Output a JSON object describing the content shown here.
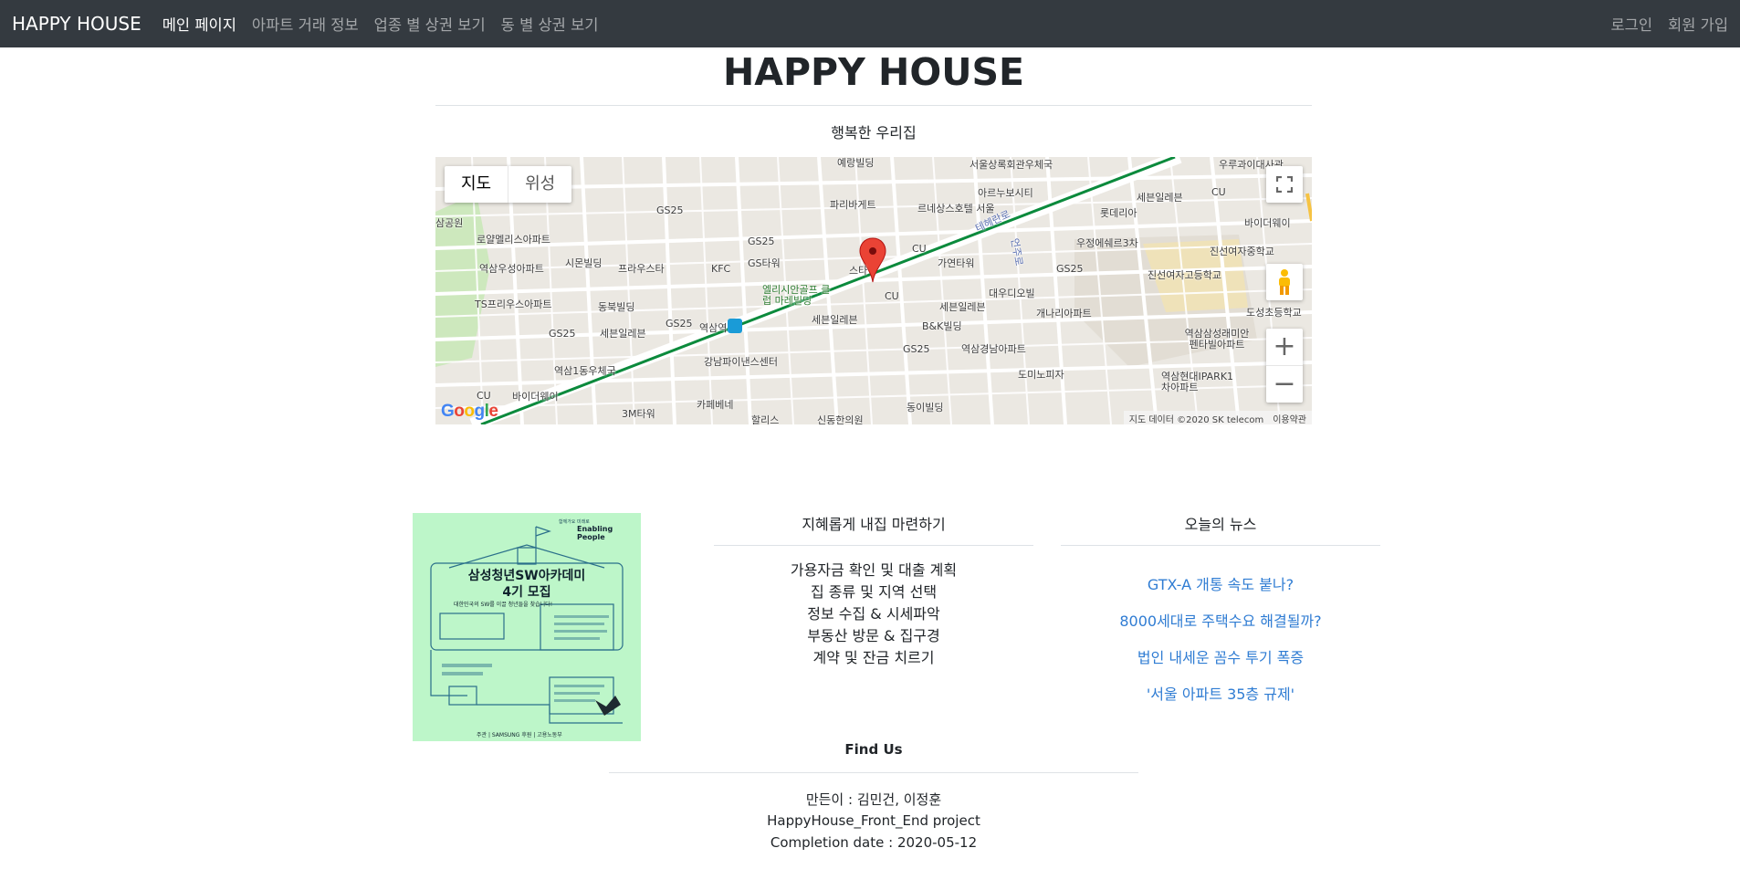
{
  "navbar": {
    "brand": "HAPPY HOUSE",
    "left_links": [
      "메인 페이지",
      "아파트 거래 정보",
      "업종 별 상권 보기",
      "동 별 상권 보기"
    ],
    "right_links": [
      "로그인",
      "회원 가입"
    ]
  },
  "hero": {
    "title": "HAPPY HOUSE",
    "subtitle": "행복한 우리집"
  },
  "map": {
    "type_buttons": [
      "지도",
      "위성"
    ],
    "logo_letters": [
      "G",
      "o",
      "o",
      "g",
      "l",
      "e"
    ],
    "attribution": "지도 데이터 ©2020 SK telecom",
    "terms": "이용약관",
    "labels": {
      "l1": "서울상록회관우체국",
      "l2": "예랑빌딩",
      "l3": "우루과이대사관",
      "l4": "GS25",
      "l5": "파리바게트",
      "l6": "르네상스호텔 서울",
      "l7": "아르누보시티",
      "l8": "세븐일레븐",
      "l9": "롯데리아",
      "l10": "CU",
      "l11": "삼공원",
      "l12": "로얄멜리스아파트",
      "l13": "GS25",
      "l14": "CU",
      "l15": "우정에쉐르3차",
      "l16": "바이더웨이",
      "l17": "진선여자중학교",
      "l18": "역삼우성아파트",
      "l19": "시몬빌딩",
      "l20": "프라우스타",
      "l21": "KFC",
      "l22": "GS타워",
      "l23": "가연타워",
      "l24": "GS25",
      "l25": "진선여자고등학교",
      "l26": "TS프리우스아파트",
      "l27": "동북빌딩",
      "l28": "엘리시안골프 클럽 마레빌딩",
      "l29": "CU",
      "l30": "대우디오빌",
      "l31": "세븐일레븐",
      "l32": "개나리아파트",
      "l33": "도성초등학교",
      "l34": "GS25",
      "l35": "세븐일레븐",
      "l36": "GS25",
      "l37": "역삼역",
      "l38": "세븐일레븐",
      "l39": "B&K빌딩",
      "l40": "역삼삼성래미안 펜타빌아파트",
      "l41": "역삼1동우체국",
      "l42": "강남파이낸스센터",
      "l43": "GS25",
      "l44": "역삼경남아파트",
      "l45": "도미노피자",
      "l46": "CU",
      "l47": "바이더웨이",
      "l48": "역삼현대IPARK1 차아파트",
      "l49": "3M타워",
      "l50": "카페베네",
      "l51": "할리스",
      "l52": "신동한의원",
      "l53": "동이빌딩",
      "l54": "테헤란로",
      "l55": "언주로",
      "l56": "스타"
    }
  },
  "poster": {
    "kicker": "함께가요 미래로",
    "brand_line": "Enabling People",
    "title_line1": "삼성청년SW아카데미",
    "title_line2": "4기 모집",
    "tagline": "대한민국의 SW를 이끌 청년들을 찾습니다!",
    "footer": "주관 | SAMSUNG   후원 | 고용노동부"
  },
  "plan": {
    "title": "지혜롭게 내집 마련하기",
    "items": [
      "가용자금 확인 및 대출 계획",
      "집 종류 및 지역 선택",
      "정보 수집 & 시세파악",
      "부동산 방문 & 집구경",
      "계약 및 잔금 치르기"
    ]
  },
  "news": {
    "title": "오늘의 뉴스",
    "items": [
      "GTX-A 개통 속도 붙나?",
      "8000세대로 주택수요 해결될까?",
      "법인 내세운 꼼수 투기 폭증",
      "'서울 아파트 35층 규제'"
    ]
  },
  "footer": {
    "find_us": "Find Us",
    "authors": "만든이 : 김민건, 이정훈",
    "project": "HappyHouse_Front_End project",
    "completion": "Completion date : 2020-05-12"
  },
  "colors": {
    "navbar_bg": "#343a40",
    "link_blue": "#2f7cd3",
    "poster_bg": "#bdf6c9",
    "map_line_green": "#0b8a3c",
    "marker_red": "#ea4335"
  }
}
